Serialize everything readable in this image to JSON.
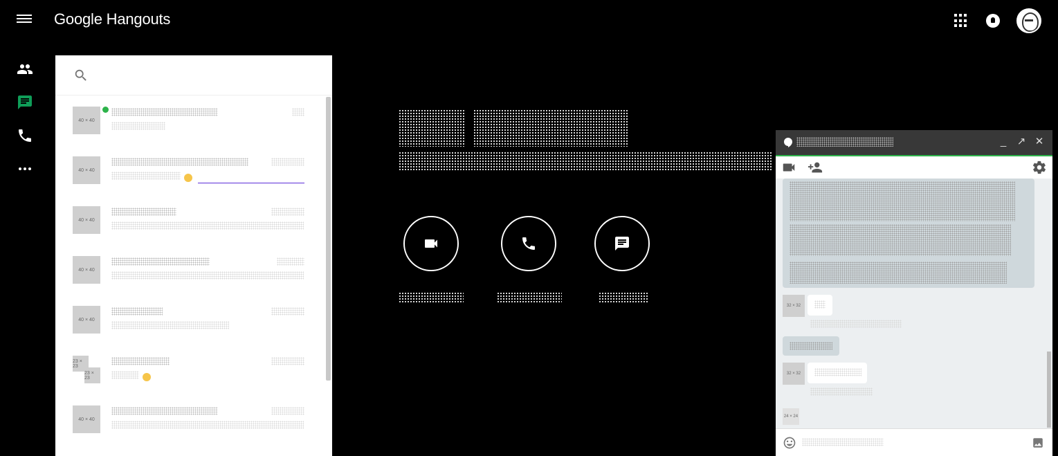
{
  "header": {
    "title": "Google Hangouts"
  },
  "icons": {
    "menu": "menu-icon",
    "apps": "apps-icon",
    "notifications": "bell-icon",
    "account": "avatar"
  },
  "nav": [
    {
      "name": "contacts",
      "icon": "people-icon"
    },
    {
      "name": "conversations",
      "icon": "chat-icon",
      "active": true,
      "active_color": "#0f9d58"
    },
    {
      "name": "phone-calls",
      "icon": "phone-icon"
    },
    {
      "name": "more",
      "icon": "more-icon"
    }
  ],
  "conversations": {
    "thumb_label": "40 × 40",
    "duo_thumb_label": "23 × 23",
    "online_color": "#2db34a"
  },
  "actions": [
    {
      "name": "video-call",
      "icon": "videocam-icon"
    },
    {
      "name": "phone-call",
      "icon": "phone-icon"
    },
    {
      "name": "message",
      "icon": "message-icon"
    }
  ],
  "chat": {
    "controls": {
      "minimize": "_",
      "popout": "↗",
      "close": "✕"
    },
    "thumb_label": "32 × 32",
    "small_thumb_label": "24 × 24",
    "accent": "#2db34a"
  }
}
